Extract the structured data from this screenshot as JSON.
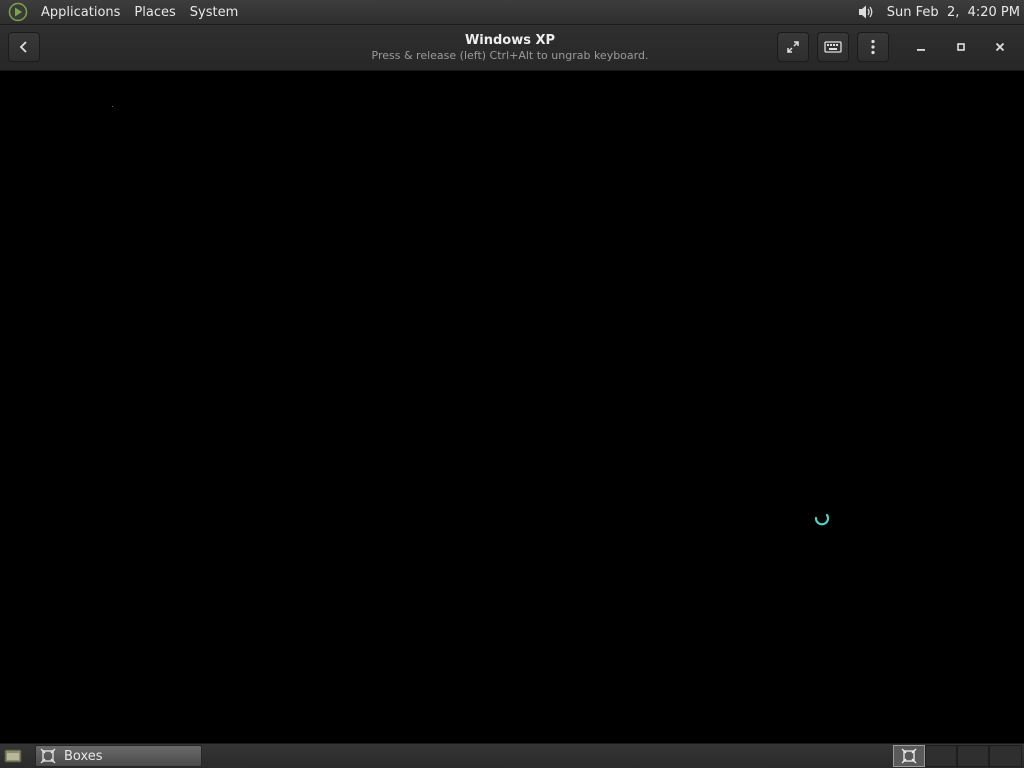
{
  "top_panel": {
    "logo_icon": "mate-logo-icon",
    "menus": [
      "Applications",
      "Places",
      "System"
    ],
    "volume_icon": "speaker-icon",
    "clock": "Sun Feb  2,  4:20 PM"
  },
  "headerbar": {
    "title": "Windows XP",
    "subtitle": "Press & release (left) Ctrl+Alt to ungrab keyboard.",
    "buttons": {
      "back": "back-icon",
      "fullscreen": "fullscreen-icon",
      "keyboard": "keyboard-icon",
      "menu": "kebab-menu-icon",
      "minimize": "minimize-icon",
      "maximize": "maximize-icon",
      "close": "close-icon"
    }
  },
  "vm_display": {
    "state": "loading",
    "spinner_color": "#4fd1c5"
  },
  "bottom_panel": {
    "taskbar_items": [
      {
        "label": "Boxes",
        "icon": "boxes-icon",
        "active": true
      }
    ],
    "workspaces": 4,
    "active_workspace": 1
  },
  "colors": {
    "panel_bg": "#2e2e2e",
    "headerbar_bg": "#2a2a2a",
    "vm_bg": "#000000",
    "accent": "#4fd1c5"
  }
}
